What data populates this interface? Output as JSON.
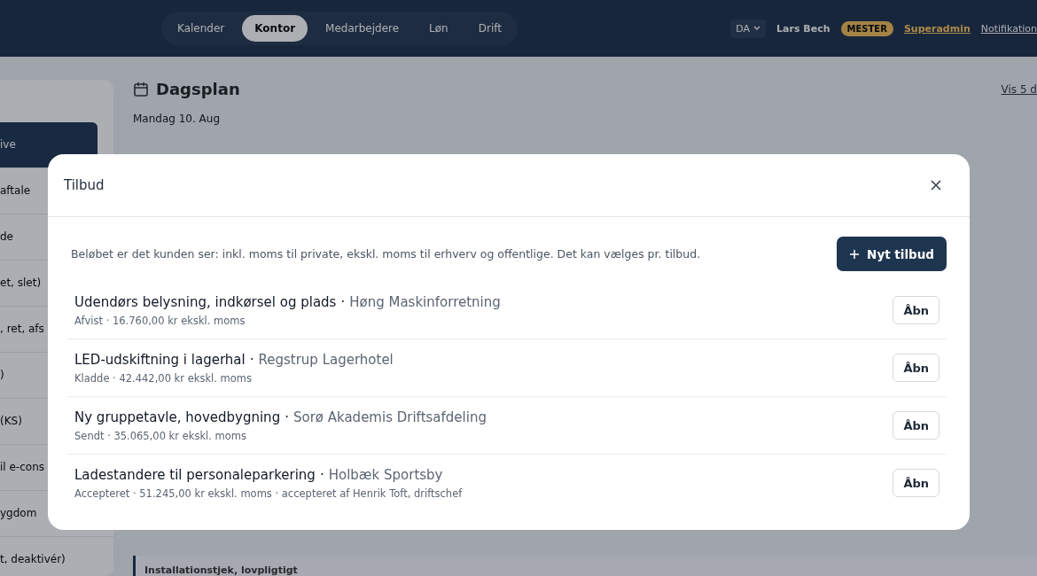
{
  "nav": {
    "tabs": [
      {
        "label": "Kalender",
        "selected": false
      },
      {
        "label": "Kontor",
        "selected": true
      },
      {
        "label": "Medarbejdere",
        "selected": false
      },
      {
        "label": "Løn",
        "selected": false
      },
      {
        "label": "Drift",
        "selected": false
      }
    ],
    "language": "DA",
    "user": "Lars Bech",
    "role_badge": "MESTER",
    "admin_link": "Superadmin",
    "notifications_link": "Notifikation"
  },
  "sidebar": {
    "items": [
      {
        "label": "ive",
        "selected": true
      },
      {
        "label": "aftale",
        "selected": false
      },
      {
        "label": "de",
        "selected": false
      },
      {
        "label": "et, slet)",
        "selected": false
      },
      {
        "label": ", ret, afs",
        "selected": false
      },
      {
        "label": ")",
        "selected": false
      },
      {
        "label": "(KS)",
        "selected": false
      },
      {
        "label": "il e-cons",
        "selected": false
      },
      {
        "label": "ygdom",
        "selected": false
      },
      {
        "label": "t, deaktivér)",
        "selected": false
      }
    ]
  },
  "dayplan": {
    "title": "Dagsplan",
    "date": "Mandag 10. Aug",
    "link": "Vis 5 d",
    "bottom_entry": "Installationstjek, lovpligtigt"
  },
  "modal": {
    "title": "Tilbud",
    "description": "Beløbet er det kunden ser: inkl. moms til private, ekskl. moms til erhverv og offentlige. Det kan vælges pr. tilbud.",
    "new_button": "Nyt tilbud",
    "offers": [
      {
        "title": "Udendørs belysning, indkørsel og plads",
        "customer": "Høng Maskinforretning",
        "separator": "·",
        "details": "Afvist · 16.760,00 kr ekskl. moms",
        "action": "Åbn"
      },
      {
        "title": "LED-udskiftning i lagerhal",
        "customer": "Regstrup Lagerhotel",
        "separator": "·",
        "details": "Kladde · 42.442,00 kr ekskl. moms",
        "action": "Åbn"
      },
      {
        "title": "Ny gruppetavle, hovedbygning",
        "customer": "Sorø Akademis Driftsafdeling",
        "separator": "·",
        "details": "Sendt · 35.065,00 kr ekskl. moms",
        "action": "Åbn"
      },
      {
        "title": "Ladestandere til personaleparkering",
        "customer": "Holbæk Sportsby",
        "separator": "·",
        "details": "Accepteret · 51.245,00 kr ekskl. moms · accepteret af Henrik Toft, driftschef",
        "action": "Åbn"
      }
    ]
  }
}
